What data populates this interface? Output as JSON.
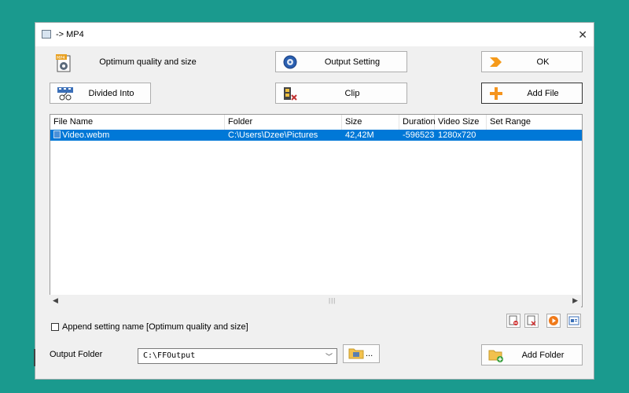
{
  "window": {
    "title": "-> MP4"
  },
  "toolbar": {
    "profile_label": "Optimum quality and size",
    "output_setting_label": "Output Setting",
    "ok_label": "OK",
    "divided_into_label": "Divided Into",
    "clip_label": "Clip",
    "add_file_label": "Add File"
  },
  "table": {
    "columns": [
      "File Name",
      "Folder",
      "Size",
      "Duration",
      "Video Size",
      "Set Range"
    ],
    "rows": [
      {
        "file_name": "Video.webm",
        "folder": "C:\\Users\\Dzee\\Pictures",
        "size": "42,42M",
        "duration": "-596523:",
        "video_size": "1280x720",
        "set_range": ""
      }
    ]
  },
  "append_setting": {
    "label": "Append setting name [Optimum quality and size]",
    "checked": false
  },
  "output": {
    "label": "Output Folder",
    "folder_value": "C:\\FFOutput",
    "browse_label": "...",
    "add_folder_label": "Add Folder"
  },
  "icons": {
    "app": "app-icon",
    "close": "close-icon",
    "profile": "mp4-file-icon",
    "output_setting": "settings-disc-icon",
    "ok": "arrow-right-icon",
    "divided": "film-split-icon",
    "clip": "film-scissors-icon",
    "add_file": "plus-icon"
  },
  "colors": {
    "accent": "#0078d7",
    "background": "#1a9a8e",
    "window": "#f0f0f0"
  }
}
